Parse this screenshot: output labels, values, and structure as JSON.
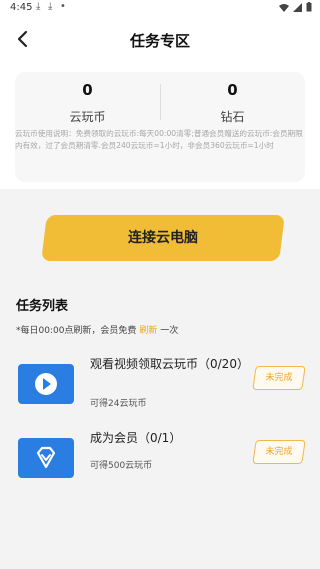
{
  "status_bar": {
    "time": "4:45"
  },
  "header": {
    "title": "任务专区"
  },
  "balances": {
    "cloud_coins": {
      "value": "0",
      "label": "云玩币"
    },
    "diamonds": {
      "value": "0",
      "label": "钻石"
    },
    "note": "云玩币使用说明：免费领取的云玩币:每天00:00清零;普通会员赠送的云玩币:会员期限内有效，过了会员期清零.会员240云玩币=1小时，非会员360云玩币=1小时"
  },
  "connect_button": {
    "label": "连接云电脑"
  },
  "task_list": {
    "title": "任务列表",
    "note_prefix": "*每日00:00点刷新，会员免费 ",
    "note_link": "刷新",
    "note_suffix": " 一次",
    "items": [
      {
        "name": "观看视频领取云玩币（0/20）",
        "reward": "可得24云玩币",
        "status": "未完成",
        "icon": "play-icon"
      },
      {
        "name": "成为会员（0/1）",
        "reward": "可得500云玩币",
        "status": "未完成",
        "icon": "diamond-icon"
      }
    ]
  },
  "colors": {
    "accent": "#f1bd36",
    "link": "#f0a41a",
    "icon_bg": "#2a7ee2"
  }
}
